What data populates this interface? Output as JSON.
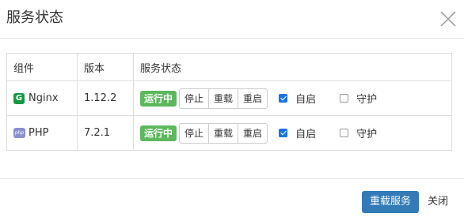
{
  "dialog": {
    "title": "服务状态",
    "close_icon": "close-icon"
  },
  "table": {
    "headers": [
      "组件",
      "版本",
      "服务状态"
    ],
    "rows": [
      {
        "name": "Nginx",
        "icon": "nginx-icon",
        "icon_text": "G",
        "version": "1.12.2",
        "status": "运行中",
        "status_color": "#5cb85c",
        "actions": [
          "停止",
          "重载",
          "重启"
        ],
        "autostart_label": "自启",
        "autostart_checked": true,
        "guard_label": "守护",
        "guard_checked": false
      },
      {
        "name": "PHP",
        "icon": "php-icon",
        "icon_text": "php",
        "version": "7.2.1",
        "status": "运行中",
        "status_color": "#5cb85c",
        "actions": [
          "停止",
          "重载",
          "重启"
        ],
        "autostart_label": "自启",
        "autostart_checked": true,
        "guard_label": "守护",
        "guard_checked": false
      }
    ]
  },
  "footer": {
    "reload_label": "重载服务",
    "close_label": "关闭"
  },
  "colors": {
    "primary": "#337ab7",
    "running": "#5cb85c",
    "checkbox": "#1a73e8"
  }
}
